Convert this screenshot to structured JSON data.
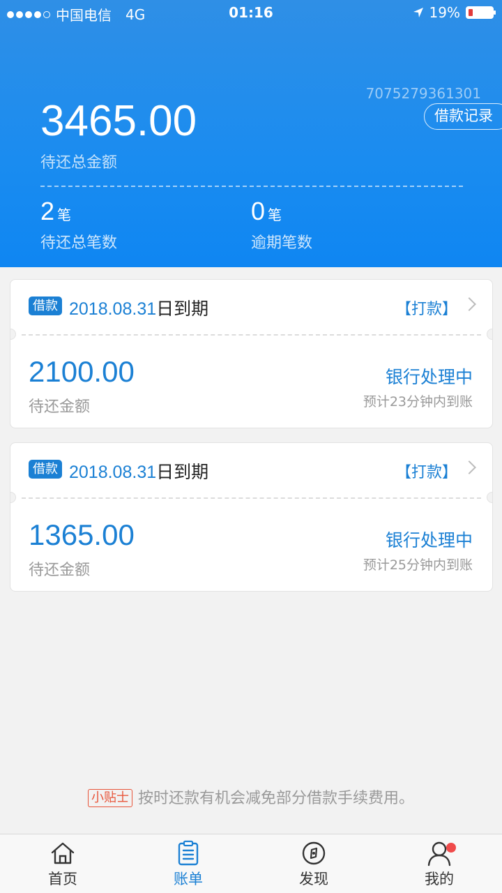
{
  "status_bar": {
    "carrier": "中国电信",
    "network": "4G",
    "time": "01:16",
    "battery": "19%"
  },
  "header": {
    "account_no": "7075279361301",
    "records_button": "借款记录",
    "total_amount": "3465.00",
    "total_label": "待还总金额",
    "stats": [
      {
        "num": "2",
        "unit": "笔",
        "label": "待还总笔数"
      },
      {
        "num": "0",
        "unit": "笔",
        "label": "逾期笔数"
      }
    ]
  },
  "loans": [
    {
      "tag": "借款",
      "date": "2018.08.31",
      "due_suffix": "日到期",
      "action": "【打款】",
      "amount": "2100.00",
      "amount_label": "待还金额",
      "status": "银行处理中",
      "eta": "预计23分钟内到账"
    },
    {
      "tag": "借款",
      "date": "2018.08.31",
      "due_suffix": "日到期",
      "action": "【打款】",
      "amount": "1365.00",
      "amount_label": "待还金额",
      "status": "银行处理中",
      "eta": "预计25分钟内到账"
    }
  ],
  "tip": {
    "badge": "小贴士",
    "text": "按时还款有机会减免部分借款手续费用。"
  },
  "tabs": [
    {
      "label": "首页",
      "icon": "home-icon"
    },
    {
      "label": "账单",
      "icon": "bill-icon"
    },
    {
      "label": "发现",
      "icon": "compass-icon"
    },
    {
      "label": "我的",
      "icon": "user-icon"
    }
  ],
  "colors": {
    "accent": "#1b80d4",
    "header": "#1a8cf0",
    "tip": "#e8553a"
  }
}
